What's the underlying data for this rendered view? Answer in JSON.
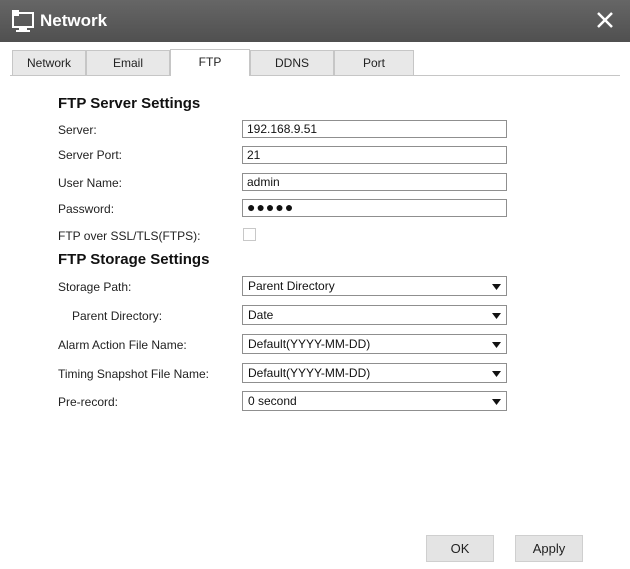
{
  "window": {
    "title": "Network"
  },
  "tabs": [
    "Network",
    "Email",
    "FTP",
    "DDNS",
    "Port"
  ],
  "ftp_server": {
    "title": "FTP Server Settings",
    "server_label": "Server:",
    "server_value": "192.168.9.51",
    "port_label": "Server Port:",
    "port_value": "21",
    "username_label": "User Name:",
    "username_value": "admin",
    "password_label": "Password:",
    "password_dots": "●●●●●",
    "ssl_label": "FTP over SSL/TLS(FTPS):",
    "ssl_checked": false
  },
  "ftp_storage": {
    "title": "FTP Storage Settings",
    "storage_path_label": "Storage Path:",
    "storage_path_value": "Parent Directory",
    "parent_dir_label": "Parent Directory:",
    "parent_dir_value": "Date",
    "alarm_label": "Alarm Action File Name:",
    "alarm_value": "Default(YYYY-MM-DD)",
    "timing_label": "Timing Snapshot File Name:",
    "timing_value": "Default(YYYY-MM-DD)",
    "prerecord_label": "Pre-record:",
    "prerecord_value": "0 second"
  },
  "buttons": {
    "ok": "OK",
    "apply": "Apply"
  }
}
